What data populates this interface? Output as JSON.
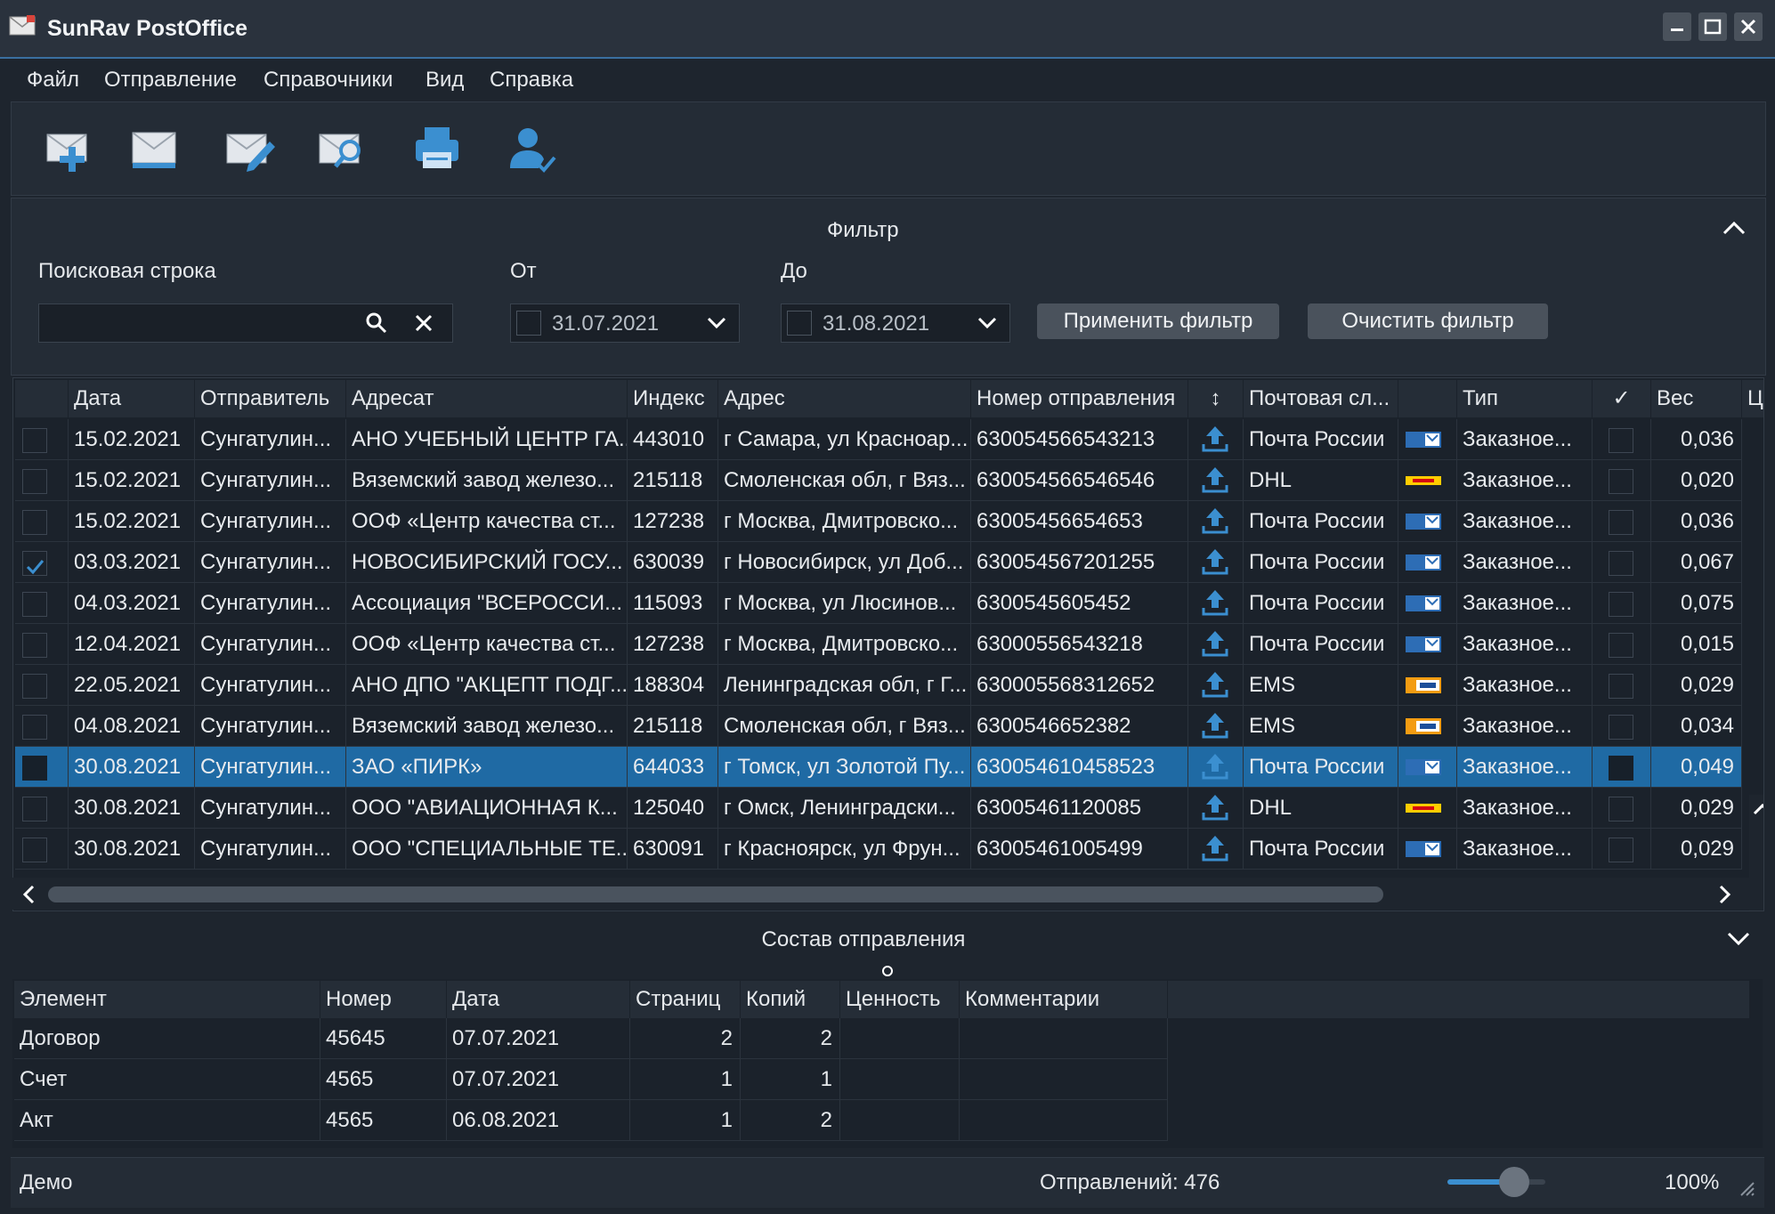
{
  "window": {
    "title": "SunRav PostOffice"
  },
  "menu": [
    "Файл",
    "Отправление",
    "Справочники",
    "Вид",
    "Справка"
  ],
  "toolbar": {
    "buttons": [
      "new-mail",
      "mail",
      "edit-mail",
      "search-mail",
      "print",
      "user-check"
    ]
  },
  "filter": {
    "title": "Фильтр",
    "search_label": "Поисковая строка",
    "search_value": "",
    "from_label": "От",
    "from_date": "31.07.2021",
    "to_label": "До",
    "to_date": "31.08.2021",
    "apply_label": "Применить фильтр",
    "clear_label": "Очистить фильтр"
  },
  "grid": {
    "headers": [
      "Дата",
      "Отправитель",
      "Адресат",
      "Индекс",
      "Адрес",
      "Номер отправления",
      "↕",
      "Почтовая сл...",
      "",
      "Тип",
      "✓",
      "Вес",
      "Це"
    ],
    "rows": [
      {
        "checked": false,
        "date": "15.02.2021",
        "sender": "Сунгатулин...",
        "recipient": "АНО УЧЕБНЫЙ ЦЕНТР ГА...",
        "index": "443010",
        "address": "г Самара, ул Красноар...",
        "number": "630054566543213",
        "service": "Почта России",
        "logo": "russian-post",
        "type": "Заказное...",
        "mark": false,
        "weight": "0,036"
      },
      {
        "checked": false,
        "date": "15.02.2021",
        "sender": "Сунгатулин...",
        "recipient": "Вяземский завод железо...",
        "index": "215118",
        "address": "Смоленская обл, г Вяз...",
        "number": "630054566546546",
        "service": "DHL",
        "logo": "dhl",
        "type": "Заказное...",
        "mark": false,
        "weight": "0,020"
      },
      {
        "checked": false,
        "date": "15.02.2021",
        "sender": "Сунгатулин...",
        "recipient": "ООФ «Центр качества ст...",
        "index": "127238",
        "address": "г Москва, Дмитровско...",
        "number": "63005456654653",
        "service": "Почта России",
        "logo": "russian-post",
        "type": "Заказное...",
        "mark": false,
        "weight": "0,036"
      },
      {
        "checked": true,
        "date": "03.03.2021",
        "sender": "Сунгатулин...",
        "recipient": "НОВОСИБИРСКИЙ ГОСУ...",
        "index": "630039",
        "address": "г Новосибирск, ул Доб...",
        "number": "630054567201255",
        "service": "Почта России",
        "logo": "russian-post",
        "type": "Заказное...",
        "mark": false,
        "weight": "0,067"
      },
      {
        "checked": false,
        "date": "04.03.2021",
        "sender": "Сунгатулин...",
        "recipient": "Ассоциация \"ВСЕРОССИ...",
        "index": "115093",
        "address": "г Москва, ул Люсинов...",
        "number": "6300545605452",
        "service": "Почта России",
        "logo": "russian-post",
        "type": "Заказное...",
        "mark": false,
        "weight": "0,075"
      },
      {
        "checked": false,
        "date": "12.04.2021",
        "sender": "Сунгатулин...",
        "recipient": "ООФ «Центр качества ст...",
        "index": "127238",
        "address": "г Москва, Дмитровско...",
        "number": "63000556543218",
        "service": "Почта России",
        "logo": "russian-post",
        "type": "Заказное...",
        "mark": false,
        "weight": "0,015"
      },
      {
        "checked": false,
        "date": "22.05.2021",
        "sender": "Сунгатулин...",
        "recipient": "АНО ДПО \"АКЦЕПТ ПОДГ...",
        "index": "188304",
        "address": "Ленинградская обл, г Г...",
        "number": "630005568312652",
        "service": "EMS",
        "logo": "ems",
        "type": "Заказное...",
        "mark": false,
        "weight": "0,029"
      },
      {
        "checked": false,
        "date": "04.08.2021",
        "sender": "Сунгатулин...",
        "recipient": "Вяземский завод железо...",
        "index": "215118",
        "address": "Смоленская обл, г Вяз...",
        "number": "6300546652382",
        "service": "EMS",
        "logo": "ems",
        "type": "Заказное...",
        "mark": false,
        "weight": "0,034"
      },
      {
        "checked": false,
        "date": "30.08.2021",
        "sender": "Сунгатулин...",
        "recipient": "ЗАО «ПИРК»",
        "index": "644033",
        "address": "г Томск, ул Золотой Пу...",
        "number": "630054610458523",
        "service": "Почта России",
        "logo": "russian-post",
        "type": "Заказное...",
        "mark": false,
        "weight": "0,049",
        "selected": true
      },
      {
        "checked": false,
        "date": "30.08.2021",
        "sender": "Сунгатулин...",
        "recipient": "ООО \"АВИАЦИОННАЯ К...",
        "index": "125040",
        "address": "г Омск, Ленинградски...",
        "number": "63005461120085",
        "service": "DHL",
        "logo": "dhl",
        "type": "Заказное...",
        "mark": false,
        "weight": "0,029"
      },
      {
        "checked": false,
        "date": "30.08.2021",
        "sender": "Сунгатулин...",
        "recipient": "ООО \"СПЕЦИАЛЬНЫЕ ТЕ...",
        "index": "630091",
        "address": "г Красноярск, ул Фрун...",
        "number": "63005461005499",
        "service": "Почта России",
        "logo": "russian-post",
        "type": "Заказное...",
        "mark": false,
        "weight": "0,029"
      }
    ]
  },
  "composition": {
    "title": "Состав отправления",
    "headers": [
      "Элемент",
      "Номер",
      "Дата",
      "Страниц",
      "Копий",
      "Ценность",
      "Комментарии"
    ],
    "rows": [
      {
        "element": "Договор",
        "number": "45645",
        "date": "07.07.2021",
        "pages": "2",
        "copies": "2",
        "value": "",
        "comment": ""
      },
      {
        "element": "Счет",
        "number": "4565",
        "date": "07.07.2021",
        "pages": "1",
        "copies": "1",
        "value": "",
        "comment": ""
      },
      {
        "element": "Акт",
        "number": "4565",
        "date": "06.08.2021",
        "pages": "1",
        "copies": "2",
        "value": "",
        "comment": ""
      }
    ]
  },
  "status": {
    "mode": "Демо",
    "count": "Отправлений: 476",
    "zoom": "100%",
    "zoom_level": 0.68
  },
  "colors": {
    "accent": "#1f6aa4",
    "upload": "#3b8fd0",
    "bg": "#1e252e"
  }
}
